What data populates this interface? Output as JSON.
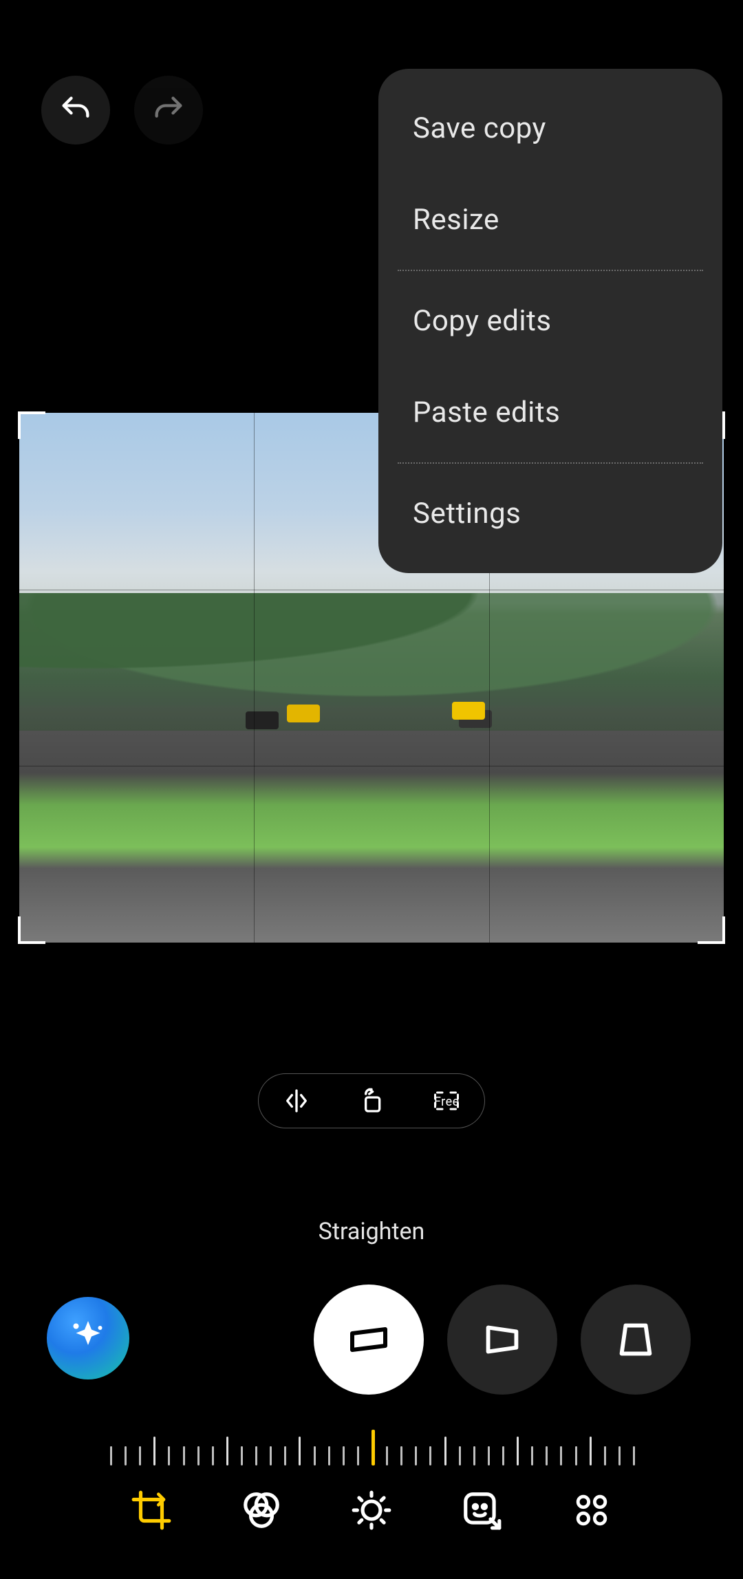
{
  "top": {
    "undo_name": "undo",
    "redo_name": "redo"
  },
  "menu": {
    "items": [
      {
        "label": "Save copy"
      },
      {
        "label": "Resize"
      },
      {
        "label": "Copy edits"
      },
      {
        "label": "Paste edits"
      },
      {
        "label": "Settings"
      }
    ]
  },
  "pill": {
    "flip": "flip-horizontal",
    "rotate": "rotate-90",
    "ratio_label": "Free"
  },
  "transform": {
    "mode_label": "Straighten",
    "modes": [
      "straighten",
      "perspective-horizontal",
      "perspective-vertical"
    ],
    "active_mode_index": 0,
    "ai_button": "ai-enhance"
  },
  "ruler": {
    "value": 0,
    "ticks": 37,
    "long_every": 5
  },
  "bottom_nav": {
    "items": [
      "crop",
      "filters",
      "adjust",
      "markup",
      "more"
    ],
    "active_index": 0
  },
  "colors": {
    "accent": "#ffcc00",
    "chip_bg": "#262626",
    "menu_bg": "#2b2b2b"
  }
}
